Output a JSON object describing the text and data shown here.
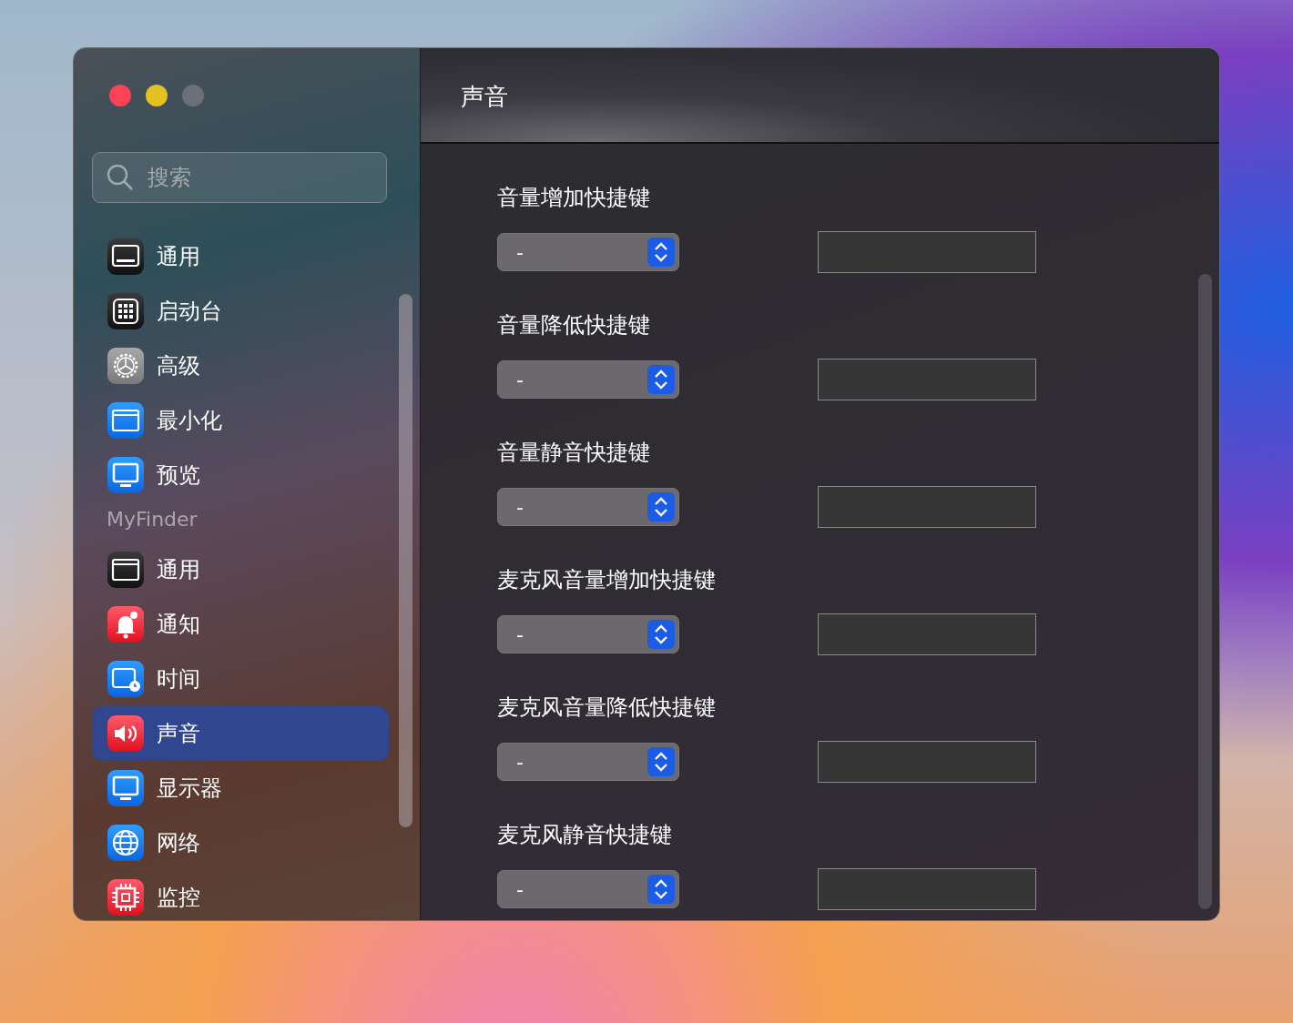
{
  "window": {
    "title": "声音",
    "controls": [
      {
        "kind": "close"
      },
      {
        "kind": "minimize"
      },
      {
        "kind": "zoom"
      }
    ]
  },
  "sidebar": {
    "search": {
      "placeholder": "搜索"
    },
    "items": [
      {
        "kind": "general",
        "label": "通用",
        "selected": false
      },
      {
        "kind": "launchpad",
        "label": "启动台",
        "selected": false
      },
      {
        "kind": "advanced",
        "label": "高级",
        "selected": false
      },
      {
        "kind": "minimize",
        "label": "最小化",
        "selected": false
      },
      {
        "kind": "preview",
        "label": "预览",
        "selected": false
      },
      {
        "kind": "header",
        "label": "MyFinder"
      },
      {
        "kind": "window",
        "label": "通用",
        "selected": false
      },
      {
        "kind": "notify",
        "label": "通知",
        "selected": false
      },
      {
        "kind": "time",
        "label": "时间",
        "selected": false
      },
      {
        "kind": "sound",
        "label": "声音",
        "selected": true
      },
      {
        "kind": "display",
        "label": "显示器",
        "selected": false
      },
      {
        "kind": "network",
        "label": "网络",
        "selected": false
      },
      {
        "kind": "monitor",
        "label": "监控",
        "selected": false
      }
    ]
  },
  "shortcuts": [
    {
      "label": "音量增加快捷键",
      "value": "-"
    },
    {
      "label": "音量降低快捷键",
      "value": "-"
    },
    {
      "label": "音量静音快捷键",
      "value": "-"
    },
    {
      "label": "麦克风音量增加快捷键",
      "value": "-"
    },
    {
      "label": "麦克风音量降低快捷键",
      "value": "-"
    },
    {
      "label": "麦克风静音快捷键",
      "value": "-"
    }
  ]
}
